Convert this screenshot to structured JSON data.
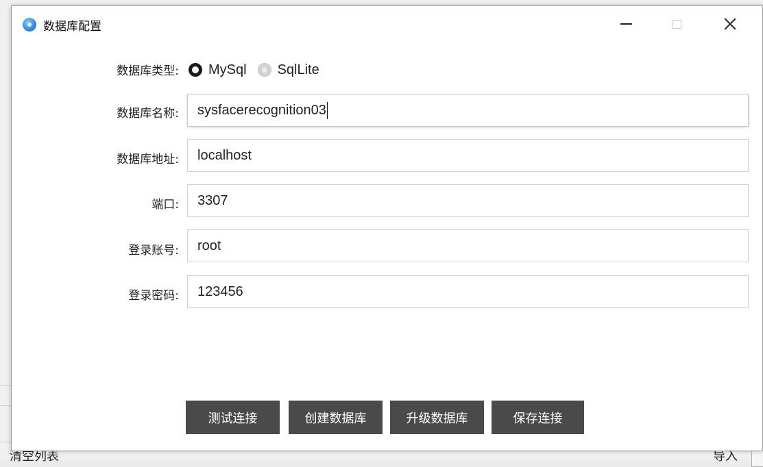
{
  "window": {
    "title": "数据库配置",
    "icon": "app-globe-icon"
  },
  "form": {
    "db_type": {
      "label": "数据库类型:",
      "options": [
        {
          "label": "MySql",
          "selected": true
        },
        {
          "label": "SqlLite",
          "selected": false
        }
      ]
    },
    "db_name": {
      "label": "数据库名称:",
      "value": "sysfacerecognition03"
    },
    "db_address": {
      "label": "数据库地址:",
      "value": "localhost"
    },
    "port": {
      "label": "端口:",
      "value": "3307"
    },
    "username": {
      "label": "登录账号:",
      "value": "root"
    },
    "password": {
      "label": "登录密码:",
      "value": "123456"
    }
  },
  "actions": {
    "test": "测试连接",
    "create": "创建数据库",
    "upgrade": "升级数据库",
    "save": "保存连接"
  },
  "background": {
    "left_text": "清空列表",
    "right_text": "导入"
  }
}
